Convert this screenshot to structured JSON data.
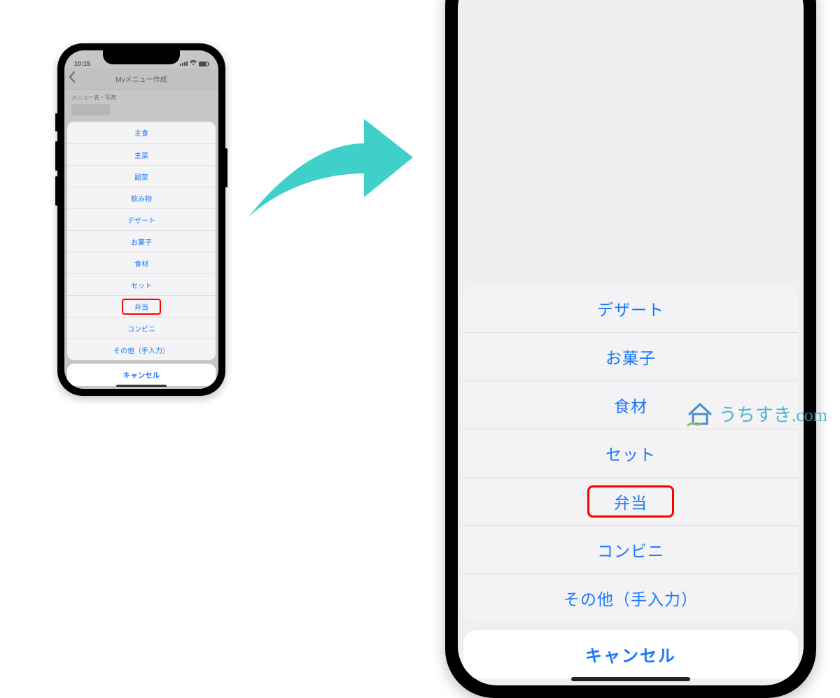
{
  "statusbar": {
    "time": "10:15"
  },
  "navbar": {
    "title": "Myメニュー作成"
  },
  "form": {
    "section_label": "メニュー名・写真"
  },
  "sheet": {
    "items": [
      {
        "label": "主食",
        "highlighted": false
      },
      {
        "label": "主菜",
        "highlighted": false
      },
      {
        "label": "副菜",
        "highlighted": false
      },
      {
        "label": "飲み物",
        "highlighted": false
      },
      {
        "label": "デザート",
        "highlighted": false
      },
      {
        "label": "お菓子",
        "highlighted": false
      },
      {
        "label": "食材",
        "highlighted": false
      },
      {
        "label": "セット",
        "highlighted": false
      },
      {
        "label": "弁当",
        "highlighted": true
      },
      {
        "label": "コンビニ",
        "highlighted": false
      },
      {
        "label": "その他（手入力）",
        "highlighted": false
      }
    ],
    "cancel": "キャンセル"
  },
  "right_sheet_start_index": 4,
  "watermark": {
    "text": "うちすき.com"
  },
  "colors": {
    "ios_blue": "#1976ff",
    "highlight_red": "#ff0000",
    "arrow_teal": "#3fd1c9"
  }
}
